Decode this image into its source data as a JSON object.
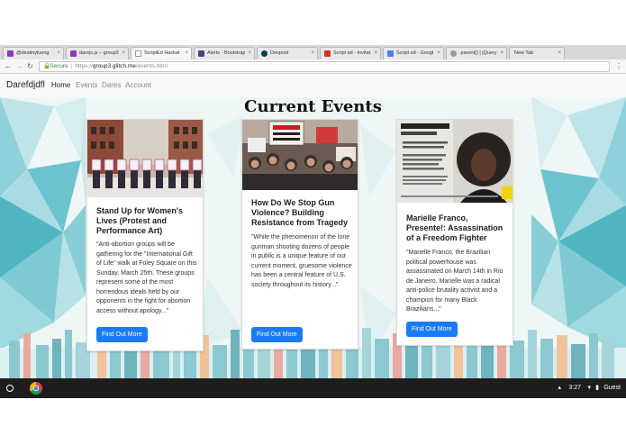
{
  "browser": {
    "tabs": [
      {
        "label": "@destinyluong",
        "favicon_color": "#8a3ab9"
      },
      {
        "label": "darejs.js – group3",
        "favicon_color": "#8a3ab9"
      },
      {
        "label": "ScriptEd Hackat",
        "favicon_color": "#ffffff",
        "active": true
      },
      {
        "label": "Alerts · Bootstrap",
        "favicon_color": "#563d7c"
      },
      {
        "label": "Devpost",
        "favicon_color": "#003e54"
      },
      {
        "label": "Script ed - Invitat",
        "favicon_color": "#d93025"
      },
      {
        "label": "Script ed - Googl",
        "favicon_color": "#4285f4"
      },
      {
        "label": ".parent() | jQuery",
        "favicon_color": "#999999"
      },
      {
        "label": "New Tab",
        "favicon_color": "#dddddd"
      }
    ],
    "address": {
      "secure_label": "Secure",
      "scheme": "https://",
      "host": "group3.glitch.me",
      "path": "/events.html"
    }
  },
  "navbar": {
    "brand": "Darefdjdfl",
    "links": [
      "Home",
      "Events",
      "Dares",
      "Account"
    ]
  },
  "main": {
    "heading": "Current Events",
    "cards": [
      {
        "image_name": "protest-photo",
        "image_letters": "PROTEST WOMEN",
        "title": "Stand Up for Women's Lives (Protest and Performance Art)",
        "text": "\"Anti-abortion groups will be gathering for the \"International Gift of Life\" walk at Foley Square on this Sunday, March 25th. These groups represent some of the most horrendous ideals held by our opponents in the fight for abortion access without apology...\"",
        "button": "Find Out More"
      },
      {
        "image_name": "rally-photo",
        "image_letters": "FEAR HAS NO PLACE IN OUR SCHOOLS",
        "title": "How Do We Stop Gun Violence? Building Resistance from Tragedy",
        "text": "\"While the phenomenon of the lone gunman shooting dozens of people in public is a unique feature of our current moment, gruesome violence has been a central feature of U.S. society throughout its history...\"",
        "button": "Find Out More"
      },
      {
        "image_name": "marielle-poster",
        "image_letters": "Marielle Franco, Presente!",
        "title": "Marielle Franco, Presente!: Assassination of a Freedom Fighter",
        "text": "\"Marielle Franco, the Brazilian political powerhouse was assassinated on March 14th in Rio de Janeiro. Marielle was a radical anti-police brutality activist and a champion for many Black Brazilians...\"",
        "button": "Find Out More"
      }
    ]
  },
  "taskbar": {
    "time": "3:27",
    "user": "Guest"
  }
}
